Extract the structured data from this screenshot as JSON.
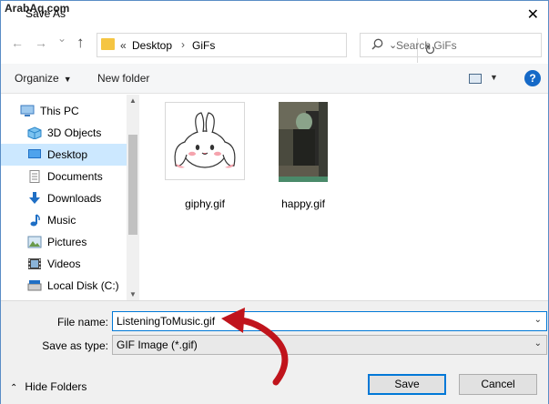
{
  "watermark": "ArabAq.com",
  "window": {
    "title": "Save As",
    "close_glyph": "✕"
  },
  "nav": {
    "back_glyph": "←",
    "forward_glyph": "→",
    "recent_glyph": "⌄",
    "up_glyph": "↑",
    "address": {
      "overflow": "«",
      "crumbs": [
        "Desktop",
        "GiFs"
      ],
      "separator": "›",
      "dropdown_glyph": "⌄",
      "refresh_glyph": "↻"
    },
    "search": {
      "placeholder": "Search GiFs"
    }
  },
  "toolbar": {
    "organize_label": "Organize",
    "new_folder_label": "New folder",
    "help_label": "?"
  },
  "sidebar": {
    "items": [
      {
        "label": "This PC",
        "icon": "computer-icon",
        "color": "#3b7bc0"
      },
      {
        "label": "3D Objects",
        "icon": "cube-icon",
        "color": "#3aa0e6"
      },
      {
        "label": "Desktop",
        "icon": "desktop-icon",
        "color": "#1f6fc5",
        "selected": true
      },
      {
        "label": "Documents",
        "icon": "document-icon",
        "color": "#8a8a8a"
      },
      {
        "label": "Downloads",
        "icon": "download-icon",
        "color": "#1f6fc5"
      },
      {
        "label": "Music",
        "icon": "music-icon",
        "color": "#1f6fc5"
      },
      {
        "label": "Pictures",
        "icon": "picture-icon",
        "color": "#6a8fb0"
      },
      {
        "label": "Videos",
        "icon": "video-icon",
        "color": "#444444"
      },
      {
        "label": "Local Disk (C:)",
        "icon": "drive-icon",
        "color": "#777777"
      }
    ],
    "scroll_up_glyph": "▲",
    "scroll_down_glyph": "▼"
  },
  "files": [
    {
      "name": "giphy.gif",
      "icon": "bunny-thumbnail-icon"
    },
    {
      "name": "happy.gif",
      "icon": "photo-thumbnail-icon"
    }
  ],
  "form": {
    "file_name_label": "File name:",
    "file_name_value": "ListeningToMusic.gif",
    "save_as_type_label": "Save as type:",
    "save_as_type_value": "GIF Image (*.gif)",
    "dropdown_glyph": "⌄"
  },
  "footer": {
    "hide_folders_label": "Hide Folders",
    "hide_folders_glyph": "⌃",
    "save_label": "Save",
    "cancel_label": "Cancel"
  },
  "colors": {
    "accent": "#0078d7",
    "selection": "#cce8ff",
    "annotation_arrow": "#c0141c",
    "help_blue": "#1569c7"
  }
}
